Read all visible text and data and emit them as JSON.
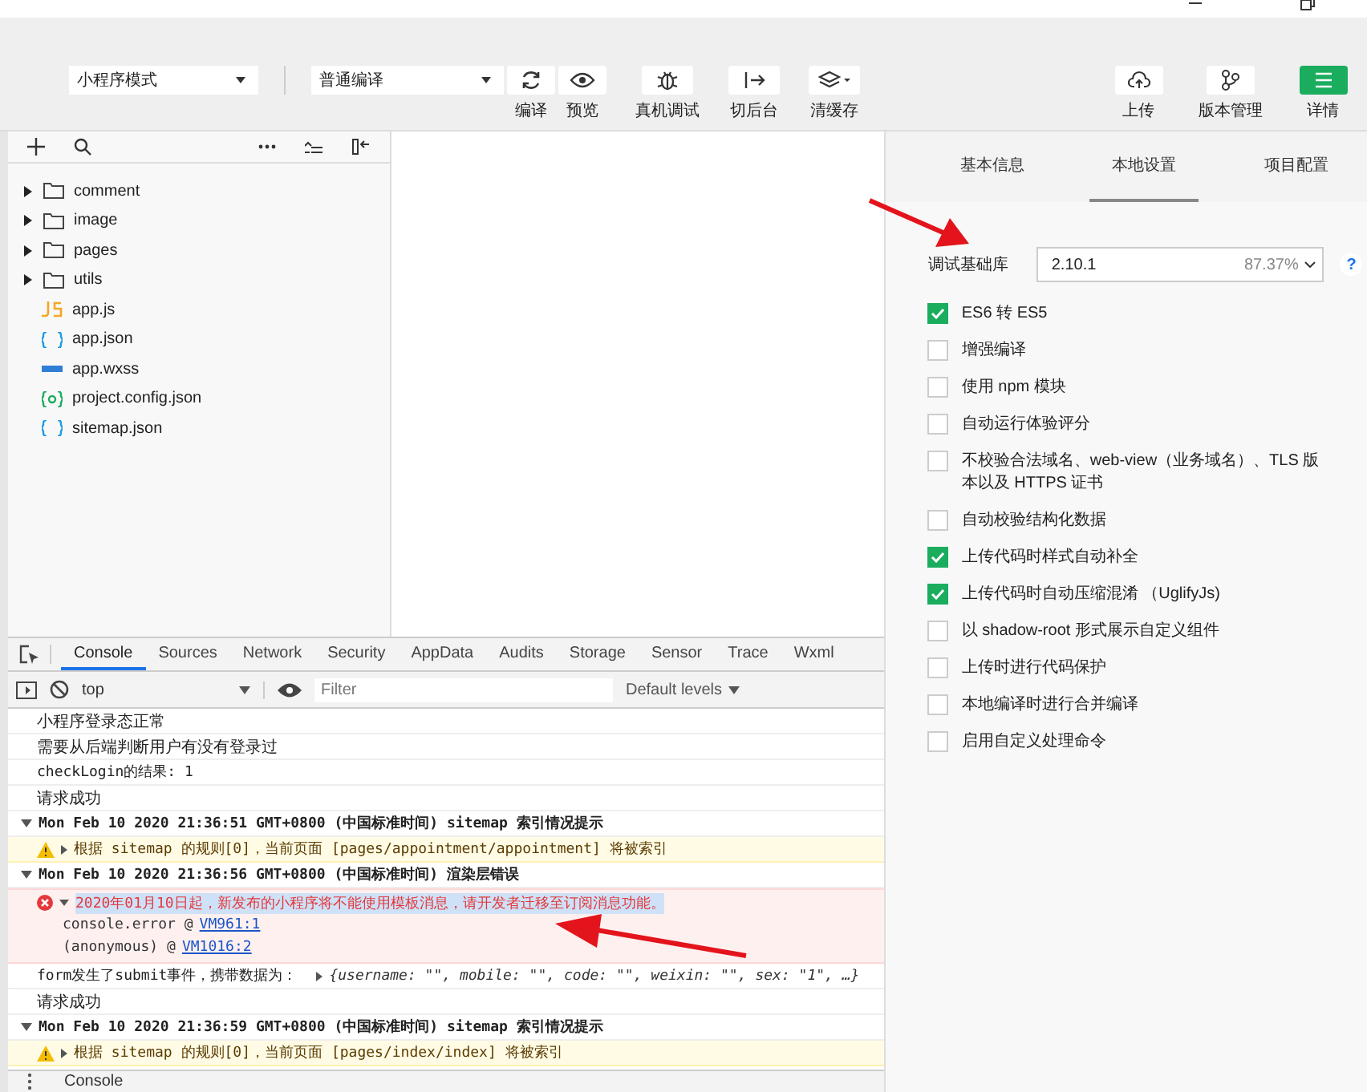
{
  "toolbar": {
    "mode_select": "小程序模式",
    "compile_select": "普通编译",
    "tools": [
      {
        "kind": "refresh",
        "label": "编译"
      },
      {
        "kind": "eye",
        "label": "预览"
      },
      {
        "kind": "bug",
        "label": "真机调试"
      },
      {
        "kind": "switch",
        "label": "切后台"
      },
      {
        "kind": "layers",
        "label": "清缓存"
      }
    ],
    "right_tools": [
      {
        "kind": "cloud",
        "label": "上传",
        "primary": false
      },
      {
        "kind": "branch",
        "label": "版本管理",
        "primary": false
      },
      {
        "kind": "menu",
        "label": "详情",
        "primary": true
      }
    ]
  },
  "file_tree": [
    {
      "kind": "folder",
      "name": "comment"
    },
    {
      "kind": "folder",
      "name": "image"
    },
    {
      "kind": "folder",
      "name": "pages"
    },
    {
      "kind": "folder",
      "name": "utils"
    },
    {
      "kind": "js",
      "name": "app.js"
    },
    {
      "kind": "json",
      "name": "app.json"
    },
    {
      "kind": "wxss",
      "name": "app.wxss"
    },
    {
      "kind": "config",
      "name": "project.config.json"
    },
    {
      "kind": "json",
      "name": "sitemap.json"
    }
  ],
  "devtools": {
    "tabs": [
      {
        "label": "Console",
        "selected": true
      },
      {
        "label": "Sources",
        "selected": false
      },
      {
        "label": "Network",
        "selected": false
      },
      {
        "label": "Security",
        "selected": false
      },
      {
        "label": "AppData",
        "selected": false
      },
      {
        "label": "Audits",
        "selected": false
      },
      {
        "label": "Storage",
        "selected": false
      },
      {
        "label": "Sensor",
        "selected": false
      },
      {
        "label": "Trace",
        "selected": false
      },
      {
        "label": "Wxml",
        "selected": false
      }
    ],
    "context": "top",
    "filter_placeholder": "Filter",
    "levels": "Default levels",
    "entries": [
      {
        "kind": "log",
        "text": "小程序登录态正常"
      },
      {
        "kind": "log",
        "text": "需要从后端判断用户有没有登录过"
      },
      {
        "kind": "code",
        "text": "checkLogin的结果: 1"
      },
      {
        "kind": "log",
        "text": "请求成功"
      },
      {
        "kind": "group",
        "text": "Mon Feb 10 2020 21:36:51 GMT+0800 (中国标准时间) sitemap 索引情况提示"
      },
      {
        "kind": "warning",
        "text": "根据 sitemap 的规则[0]，当前页面 [pages/appointment/appointment] 将被索引"
      },
      {
        "kind": "group",
        "text": "Mon Feb 10 2020 21:36:56 GMT+0800 (中国标准时间) 渲染层错误"
      },
      {
        "kind": "error",
        "text": "2020年01月10日起，新发布的小程序将不能使用模板消息，请开发者迁移至订阅消息功能。",
        "stack": [
          {
            "fn": "console.error @",
            "link": "VM961:1"
          },
          {
            "fn": "(anonymous)   @",
            "link": "VM1016:2"
          }
        ]
      },
      {
        "kind": "object",
        "text": "form发生了submit事件，携带数据为：",
        "preview": "{username: \"\", mobile: \"\", code: \"\", weixin: \"\", sex: \"1\", …}"
      },
      {
        "kind": "log",
        "text": "请求成功"
      },
      {
        "kind": "group",
        "text": "Mon Feb 10 2020 21:36:59 GMT+0800 (中国标准时间) sitemap 索引情况提示"
      },
      {
        "kind": "warning",
        "text": "根据 sitemap 的规则[0]，当前页面 [pages/index/index] 将被索引"
      }
    ],
    "drawer_tab": "Console"
  },
  "settings": {
    "tabs": [
      {
        "label": "基本信息",
        "selected": false
      },
      {
        "label": "本地设置",
        "selected": true
      },
      {
        "label": "项目配置",
        "selected": false
      }
    ],
    "base_lib_label": "调试基础库",
    "base_lib_value": "2.10.1",
    "base_lib_share": "87.37%",
    "help": "?",
    "options": [
      {
        "label": "ES6 转 ES5",
        "checked": true
      },
      {
        "label": "增强编译",
        "checked": false
      },
      {
        "label": "使用 npm 模块",
        "checked": false
      },
      {
        "label": "自动运行体验评分",
        "checked": false
      },
      {
        "label": "不校验合法域名、web-view（业务域名）、TLS 版本以及 HTTPS 证书",
        "checked": false
      },
      {
        "label": "自动校验结构化数据",
        "checked": false
      },
      {
        "label": "上传代码时样式自动补全",
        "checked": true
      },
      {
        "label": "上传代码时自动压缩混淆 （UglifyJs)",
        "checked": true
      },
      {
        "label": "以 shadow-root 形式展示自定义组件",
        "checked": false
      },
      {
        "label": "上传时进行代码保护",
        "checked": false
      },
      {
        "label": "本地编译时进行合并编译",
        "checked": false
      },
      {
        "label": "启用自定义处理命令",
        "checked": false
      }
    ]
  }
}
